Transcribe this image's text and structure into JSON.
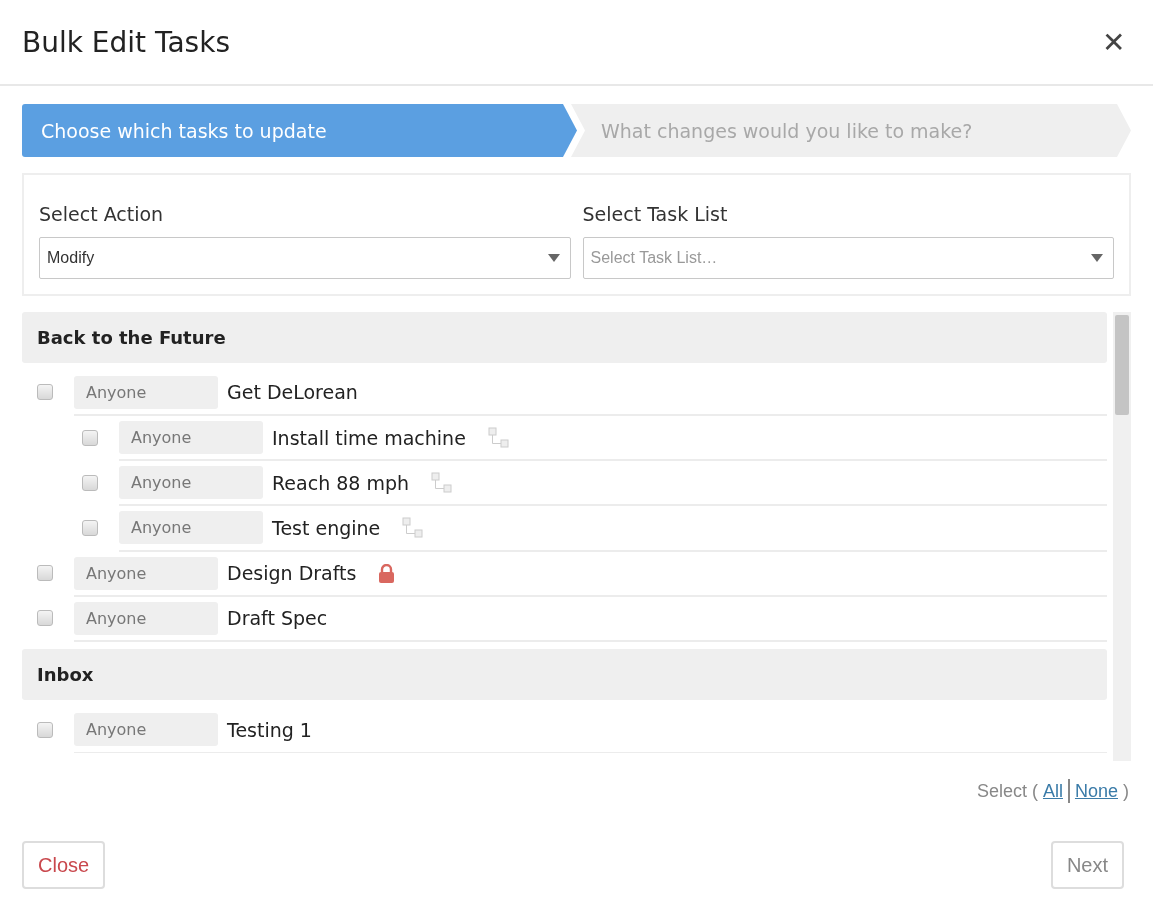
{
  "dialog": {
    "title": "Bulk Edit Tasks",
    "close_icon": "✕"
  },
  "steps": [
    {
      "label": "Choose which tasks to update",
      "selected": true
    },
    {
      "label": "What changes would you like to make?",
      "selected": false
    }
  ],
  "filters": [
    {
      "label": "Select Action",
      "value": "Modify"
    },
    {
      "label": "Select Task List",
      "placeholder": "Select Task List…"
    }
  ],
  "groups": [
    {
      "name": "Back to the Future",
      "tasks": [
        {
          "kind": "plain",
          "assignee": "Anyone",
          "name": "Get DeLorean",
          "checked": false,
          "children": [
            {
              "kind": "subtask",
              "assignee": "Anyone",
              "name": "Install time machine",
              "checked": false
            },
            {
              "kind": "subtask",
              "assignee": "Anyone",
              "name": "Reach 88 mph",
              "checked": false
            },
            {
              "kind": "subtask",
              "assignee": "Anyone",
              "name": "Test engine",
              "checked": false
            }
          ]
        },
        {
          "kind": "locked",
          "assignee": "Anyone",
          "name": "Design Drafts",
          "checked": false
        },
        {
          "kind": "plain",
          "assignee": "Anyone",
          "name": "Draft Spec",
          "checked": false
        }
      ]
    },
    {
      "name": "Inbox",
      "tasks": [
        {
          "kind": "plain",
          "assignee": "Anyone",
          "name": "Testing 1",
          "checked": false
        }
      ]
    }
  ],
  "select_links": {
    "prefix": "Select (",
    "all": "All",
    "none": "None",
    "suffix": ")"
  },
  "buttons": {
    "close": "Close",
    "next": "Next"
  }
}
